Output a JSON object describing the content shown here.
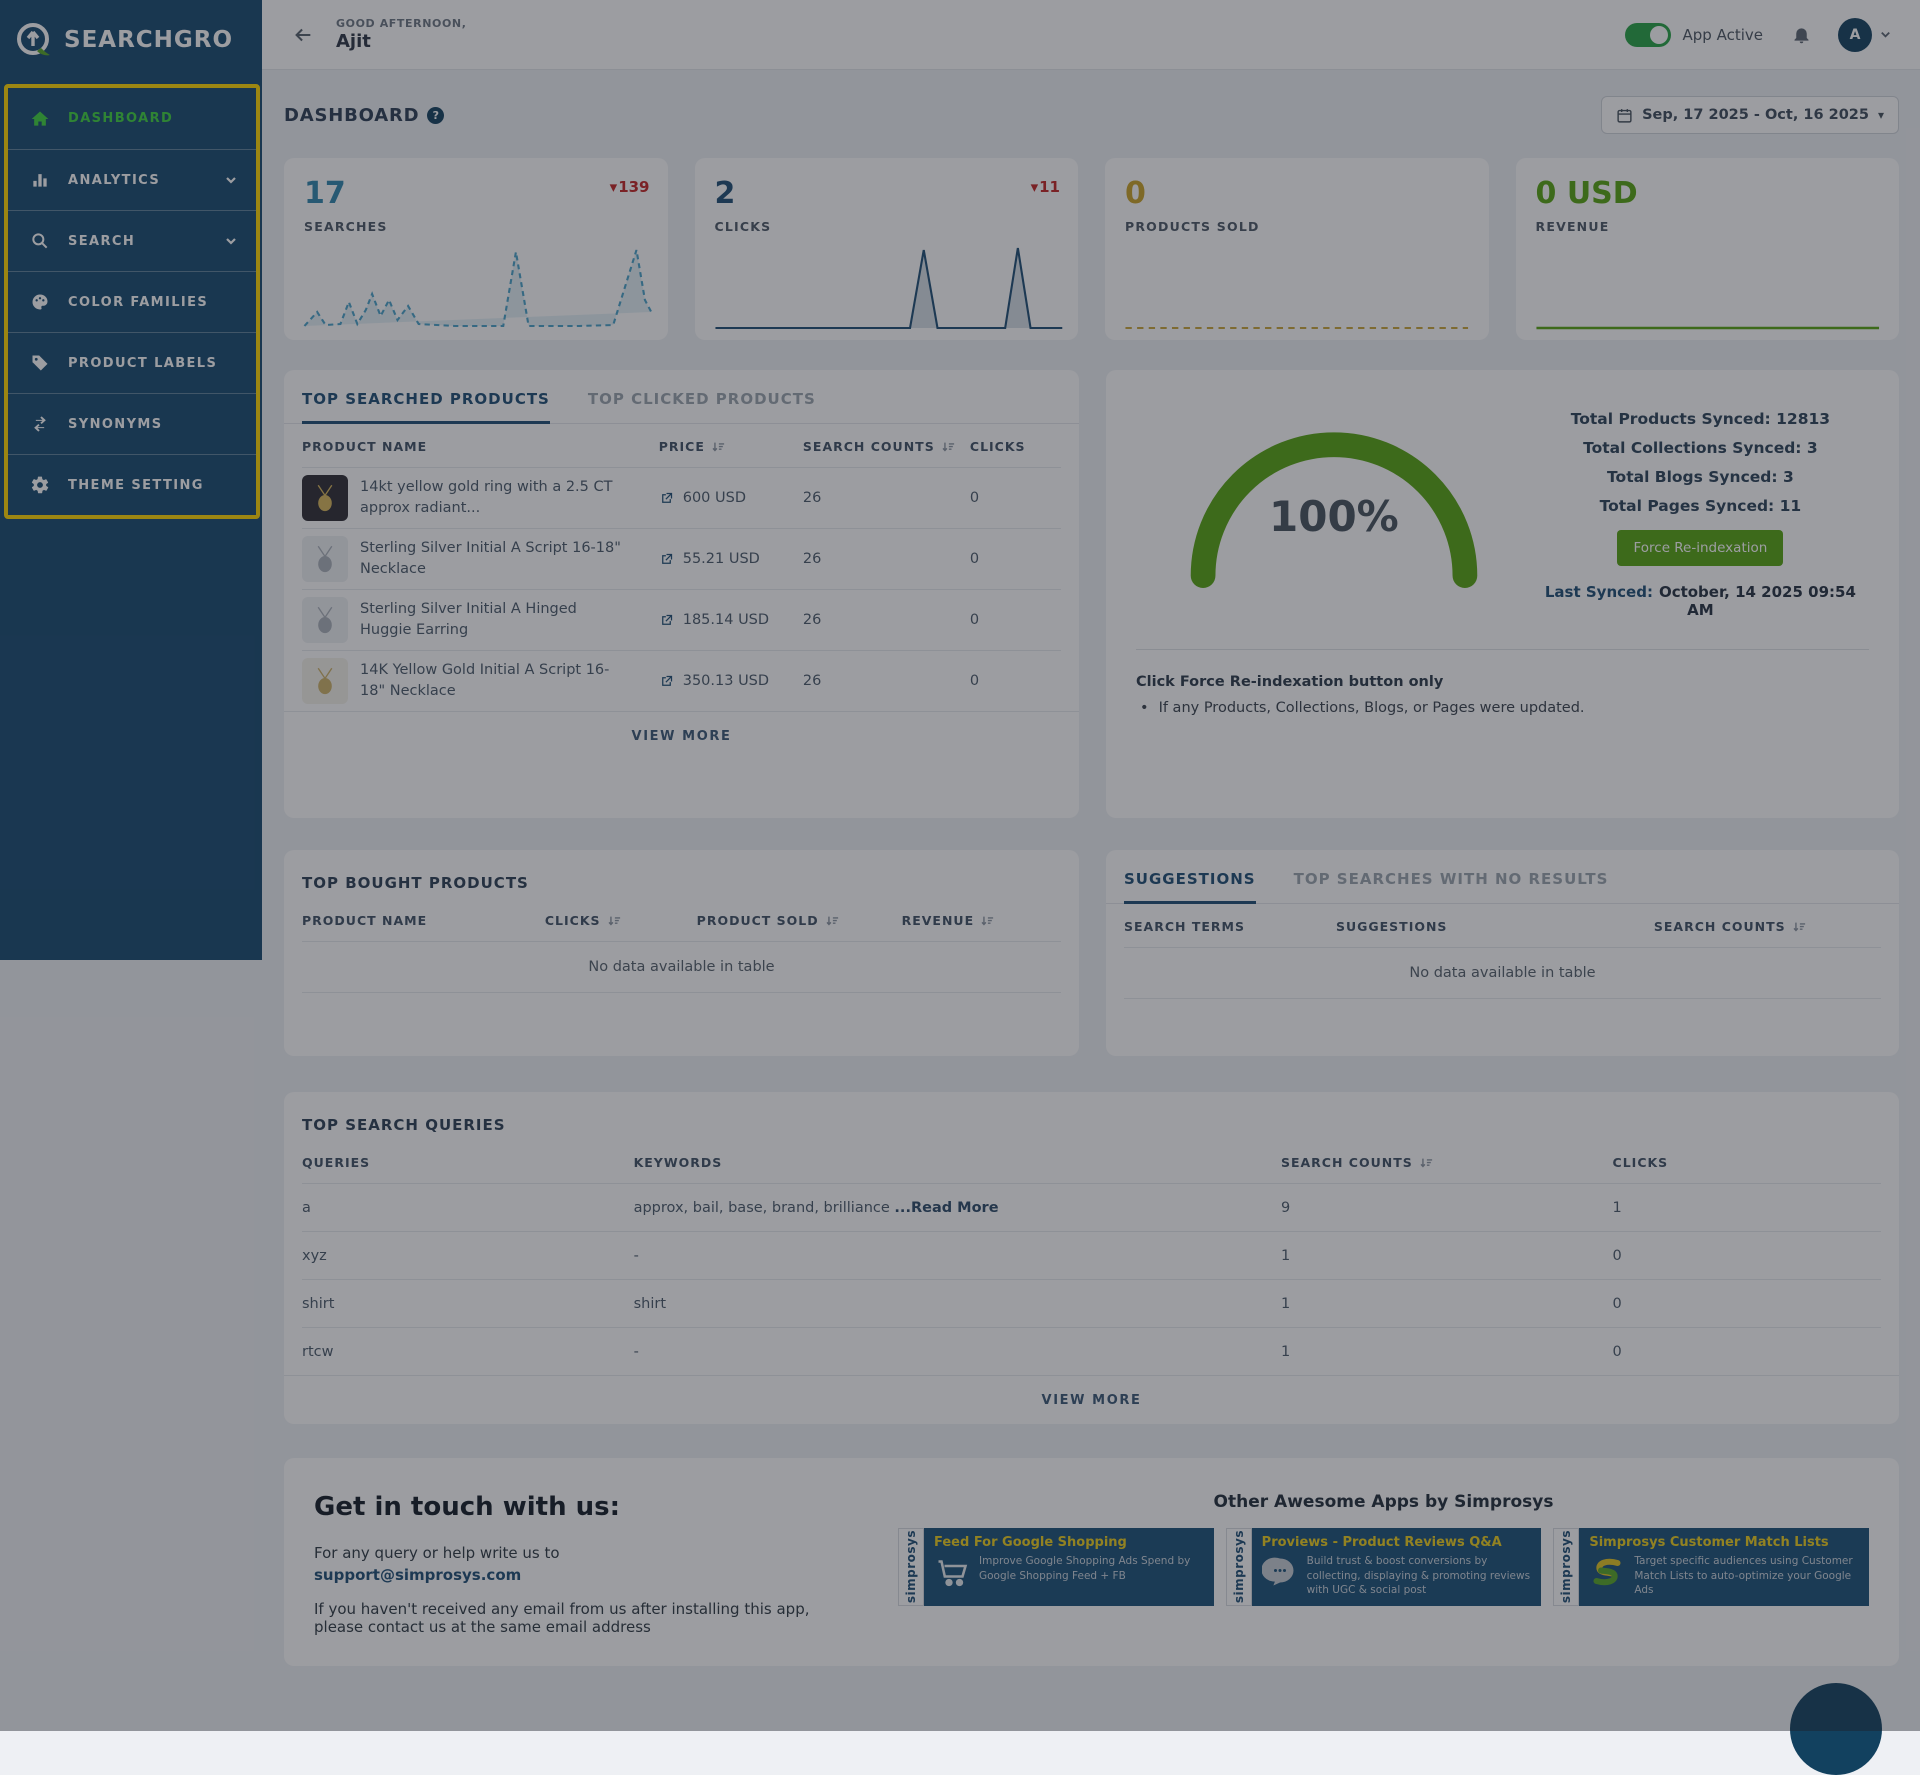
{
  "icons": {
    "delta_down": "▾",
    "caret_down": "▾",
    "bullet": "•",
    "help": "?"
  },
  "colors": {
    "accent_navy": "#1d4e75",
    "green": "#56a411",
    "teal": "#2f87ad",
    "gold": "#c9a227",
    "red": "#c22525",
    "highlight_yellow": "#ffd600",
    "sidebar_bg": "#17496f"
  },
  "sidebar": {
    "logo_text": "SEARCHGRO",
    "items": [
      {
        "label": "DASHBOARD",
        "icon": "home-icon",
        "active": true
      },
      {
        "label": "ANALYTICS",
        "icon": "bar-chart-icon",
        "chevron": true
      },
      {
        "label": "SEARCH",
        "icon": "search-icon",
        "chevron": true
      },
      {
        "label": "COLOR FAMILIES",
        "icon": "palette-icon"
      },
      {
        "label": "PRODUCT LABELS",
        "icon": "tag-icon"
      },
      {
        "label": "SYNONYMS",
        "icon": "sync-icon"
      },
      {
        "label": "THEME SETTING",
        "icon": "gear-icon"
      }
    ]
  },
  "header": {
    "greeting_small": "GOOD AFTERNOON,",
    "greeting_name": "Ajit",
    "app_toggle_label": "App Active",
    "avatar_initial": "A"
  },
  "page": {
    "title": "DASHBOARD",
    "date_range": "Sep, 17 2025 - Oct, 16 2025"
  },
  "stats": [
    {
      "value": "17",
      "label": "SEARCHES",
      "delta": "139"
    },
    {
      "value": "2",
      "label": "CLICKS",
      "delta": "11"
    },
    {
      "value": "0",
      "label": "PRODUCTS SOLD",
      "delta": ""
    },
    {
      "value": "0 USD",
      "label": "REVENUE",
      "delta": ""
    }
  ],
  "top_products": {
    "tabs": [
      "TOP SEARCHED PRODUCTS",
      "TOP CLICKED PRODUCTS"
    ],
    "columns": [
      "PRODUCT NAME",
      "PRICE",
      "SEARCH COUNTS",
      "CLICKS"
    ],
    "rows": [
      {
        "name": "14kt yellow gold ring with a 2.5 CT approx radiant...",
        "image": "gold-ring-photo",
        "price": "600 USD",
        "search_counts": "26",
        "clicks": "0"
      },
      {
        "name": "Sterling Silver Initial A Script 16-18\" Necklace",
        "image": "silver-pendant",
        "price": "55.21 USD",
        "search_counts": "26",
        "clicks": "0"
      },
      {
        "name": "Sterling Silver Initial A Hinged Huggie Earring",
        "image": "silver-earrings",
        "price": "185.14 USD",
        "search_counts": "26",
        "clicks": "0"
      },
      {
        "name": "14K Yellow Gold Initial A Script 16-18\" Necklace",
        "image": "gold-pendant",
        "price": "350.13 USD",
        "search_counts": "26",
        "clicks": "0"
      }
    ],
    "view_more": "VIEW MORE"
  },
  "sync_panel": {
    "gauge_percent": "100%",
    "totals": [
      "Total Products Synced: 12813",
      "Total Collections Synced: 3",
      "Total Blogs Synced: 3",
      "Total Pages Synced: 11"
    ],
    "button_label": "Force Re-indexation",
    "last_synced_label": "Last Synced:",
    "last_synced_value": "October, 14 2025 09:54 AM",
    "note_title": "Click Force Re-indexation button only",
    "note_bullet": "If any Products, Collections, Blogs, or Pages were updated."
  },
  "top_bought": {
    "title": "TOP BOUGHT PRODUCTS",
    "columns": [
      "PRODUCT NAME",
      "CLICKS",
      "PRODUCT SOLD",
      "REVENUE"
    ],
    "empty_text": "No data available in table"
  },
  "suggestions": {
    "tabs": [
      "SUGGESTIONS",
      "TOP SEARCHES WITH NO RESULTS"
    ],
    "columns": [
      "SEARCH TERMS",
      "SUGGESTIONS",
      "SEARCH COUNTS"
    ],
    "empty_text": "No data available in table"
  },
  "top_queries": {
    "title": "TOP SEARCH QUERIES",
    "columns": [
      "QUERIES",
      "KEYWORDS",
      "SEARCH COUNTS",
      "CLICKS"
    ],
    "rows": [
      {
        "query": "a",
        "keywords": "approx, bail, base, brand, brilliance ",
        "read_more": "...Read More",
        "search_counts": "9",
        "clicks": "1"
      },
      {
        "query": "xyz",
        "keywords": "-",
        "read_more": "",
        "search_counts": "1",
        "clicks": "0"
      },
      {
        "query": "shirt",
        "keywords": "shirt",
        "read_more": "",
        "search_counts": "1",
        "clicks": "0"
      },
      {
        "query": "rtcw",
        "keywords": "-",
        "read_more": "",
        "search_counts": "1",
        "clicks": "0"
      }
    ],
    "view_more": "VIEW MORE"
  },
  "footer": {
    "contact_title": "Get in touch with us:",
    "contact_line1": "For any query or help write us to",
    "contact_email": "support@simprosys.com",
    "contact_line2": "If you haven't received any email from us after installing this app, please contact us at the same email address",
    "apps_title": "Other Awesome Apps by Simprosys",
    "brand_strip": "simprosys",
    "apps": [
      {
        "title": "Feed For Google Shopping",
        "desc": "Improve Google Shopping Ads Spend by Google Shopping Feed + FB",
        "icon": "cart-icon"
      },
      {
        "title": "Proviews - Product Reviews Q&A",
        "desc": "Build trust & boost conversions by collecting, displaying & promoting reviews with UGC & social post",
        "icon": "speech-bubble-icon"
      },
      {
        "title": "Simprosys Customer Match Lists",
        "desc": "Target specific audiences using Customer Match Lists to auto-optimize your Google Ads",
        "icon": "s-swoosh-icon"
      }
    ]
  }
}
